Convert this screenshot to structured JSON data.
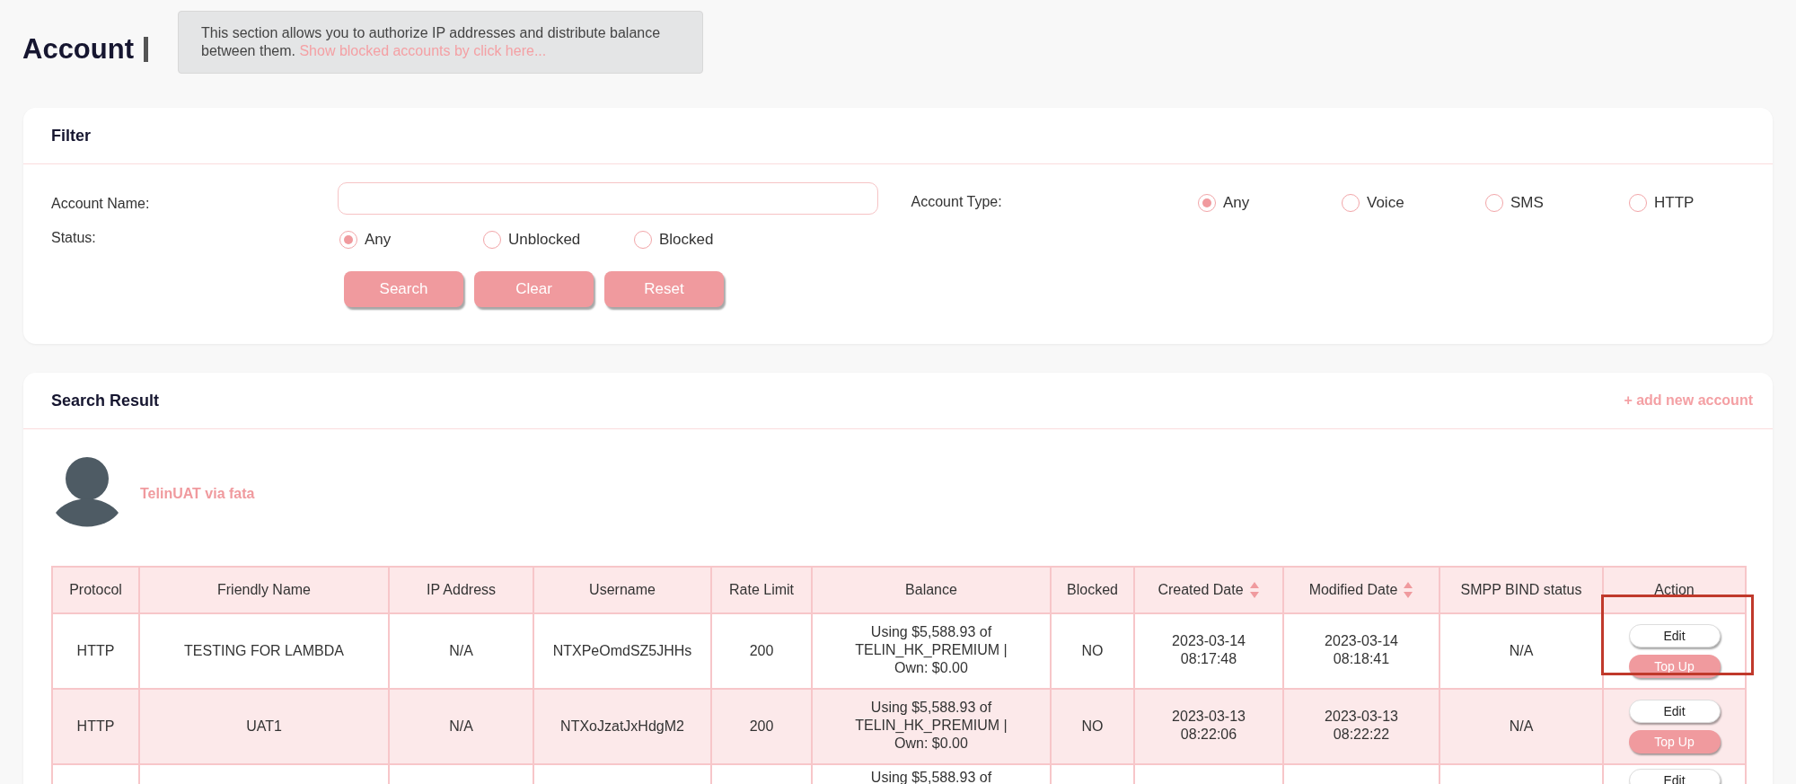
{
  "header": {
    "title": "Account",
    "description": "This section allows you to authorize IP addresses and distribute balance between them.",
    "link": "Show blocked accounts by click here..."
  },
  "filter": {
    "title": "Filter",
    "account_name": {
      "label": "Account Name:"
    },
    "account_type": {
      "label": "Account Type:",
      "options": [
        {
          "label": "Any",
          "selected": true
        },
        {
          "label": "Voice",
          "selected": false
        },
        {
          "label": "SMS",
          "selected": false
        },
        {
          "label": "HTTP",
          "selected": false
        }
      ]
    },
    "status": {
      "label": "Status:",
      "options": [
        {
          "label": "Any",
          "selected": true
        },
        {
          "label": "Unblocked",
          "selected": false
        },
        {
          "label": "Blocked",
          "selected": false
        }
      ]
    },
    "buttons": [
      "Search",
      "Clear",
      "Reset"
    ]
  },
  "results": {
    "title": "Search Result",
    "add_link": "+ add new account",
    "user": {
      "name": "TelinUAT via fata"
    },
    "table": {
      "columns": [
        {
          "label": "Protocol",
          "sortable": false
        },
        {
          "label": "Friendly Name",
          "sortable": false
        },
        {
          "label": "IP Address",
          "sortable": false
        },
        {
          "label": "Username",
          "sortable": false
        },
        {
          "label": "Rate Limit",
          "sortable": false
        },
        {
          "label": "Balance",
          "sortable": false
        },
        {
          "label": "Blocked",
          "sortable": false
        },
        {
          "label": "Created Date",
          "sortable": true
        },
        {
          "label": "Modified Date",
          "sortable": true
        },
        {
          "label": "SMPP BIND status",
          "sortable": false
        },
        {
          "label": "Action",
          "sortable": false
        }
      ],
      "rows": [
        {
          "cells": [
            "HTTP",
            "TESTING FOR LAMBDA",
            "N/A",
            "NTXPeOmdSZ5JHHs",
            "200",
            "Using $5,588.93 of TELIN_HK_PREMIUM | Own: $0.00",
            "NO",
            "2023-03-14 08:17:48",
            "2023-03-14 08:18:41",
            "N/A"
          ],
          "actions": [
            {
              "label": "Edit",
              "kind": "secondary"
            },
            {
              "label": "Top Up",
              "kind": "primary"
            }
          ]
        },
        {
          "cells": [
            "HTTP",
            "UAT1",
            "N/A",
            "NTXoJzatJxHdgM2",
            "200",
            "Using $5,588.93 of TELIN_HK_PREMIUM | Own: $0.00",
            "NO",
            "2023-03-13 08:22:06",
            "2023-03-13 08:22:22",
            "N/A"
          ],
          "actions": [
            {
              "label": "Edit",
              "kind": "secondary"
            },
            {
              "label": "Top Up",
              "kind": "primary"
            }
          ]
        },
        {
          "cells": [
            "",
            "",
            "",
            "",
            "",
            "Using $5,588.93 of",
            "",
            "",
            "",
            ""
          ],
          "actions": [
            {
              "label": "Edit",
              "kind": "secondary"
            }
          ]
        }
      ]
    }
  }
}
